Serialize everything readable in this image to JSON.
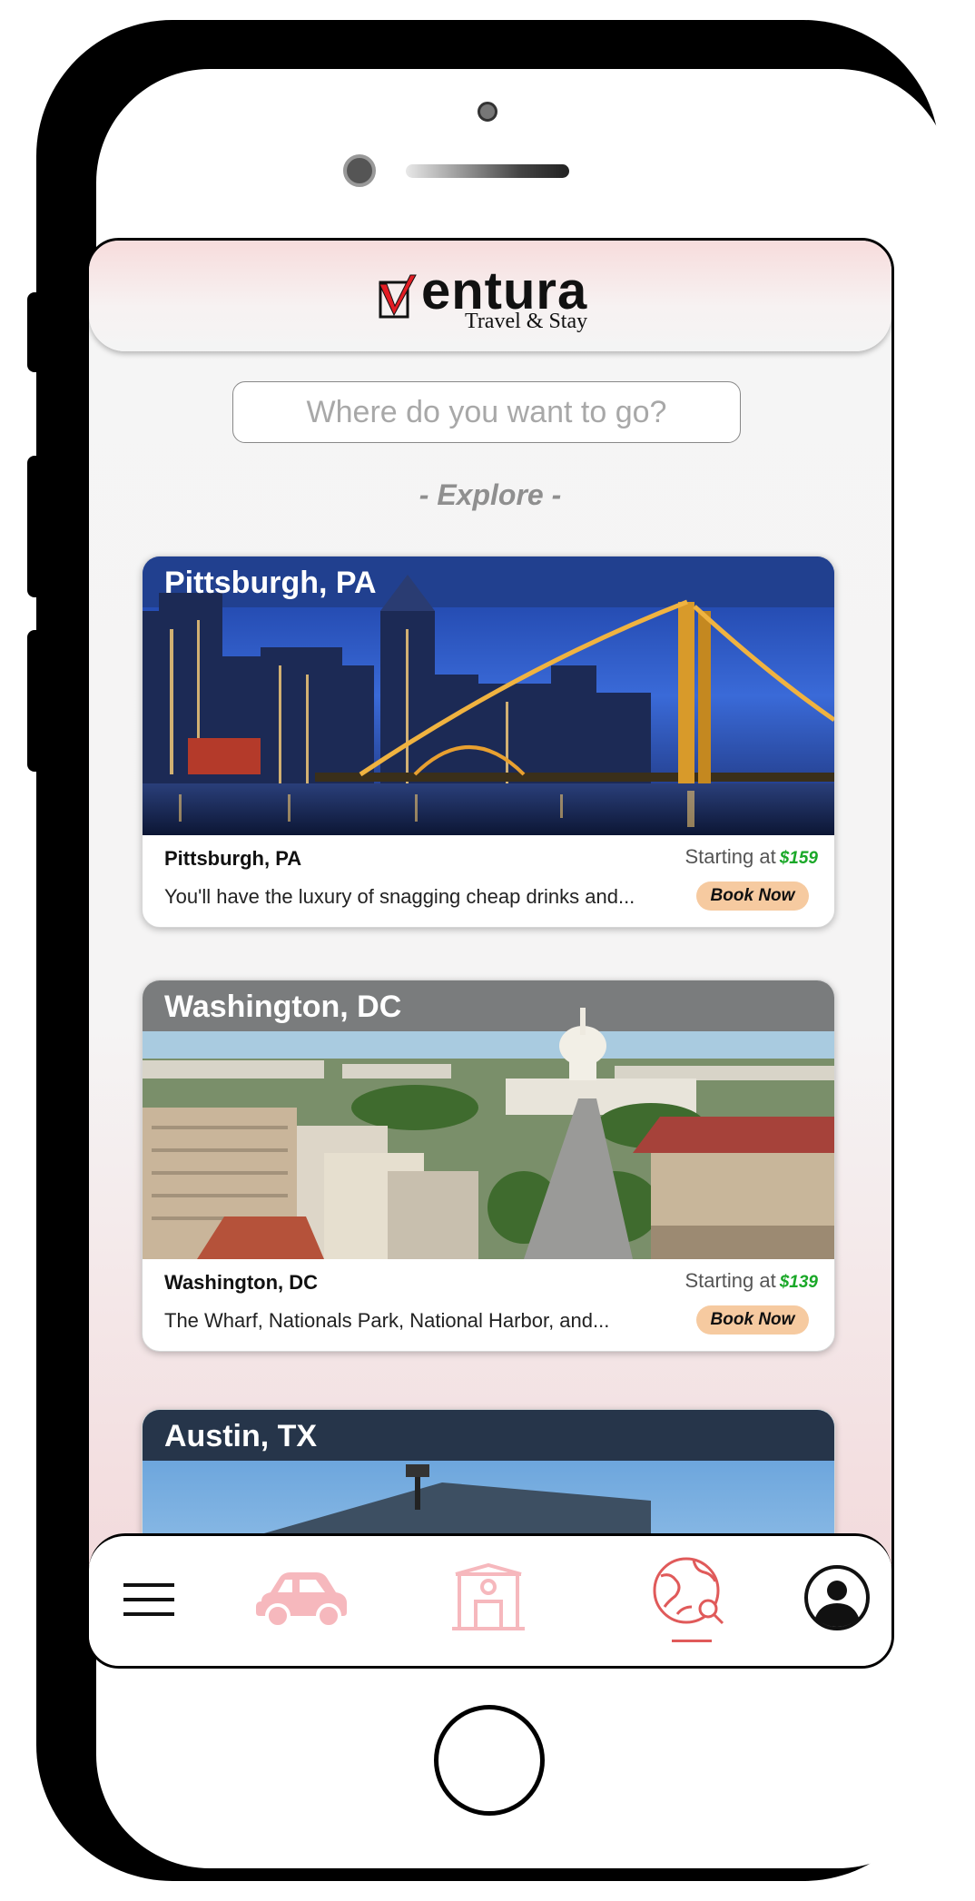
{
  "app": {
    "logo_text": "entura",
    "logo_tagline": "Travel & Stay"
  },
  "search": {
    "placeholder": "Where do you want to go?"
  },
  "section_title": "- Explore -",
  "price_prefix": "Starting at",
  "destinations": [
    {
      "title": "Pittsburgh, PA",
      "name": "Pittsburgh, PA",
      "description": "You'll have the luxury of snagging cheap drinks and...",
      "price": "$159",
      "button": "Book Now"
    },
    {
      "title": "Washington, DC",
      "name": "Washington, DC",
      "description": "The Wharf, Nationals Park, National Harbor, and...",
      "price": "$139",
      "button": "Book Now"
    },
    {
      "title": "Austin, TX"
    }
  ],
  "nav": {
    "items": [
      "menu-icon",
      "car-icon",
      "hotel-icon",
      "explore-globe-icon",
      "profile-icon"
    ],
    "active": "explore-globe-icon"
  },
  "colors": {
    "accent": "#e05a5a",
    "price_green": "#1aa828",
    "book_button": "#f6caa0",
    "nav_inactive": "#f6b8bd"
  }
}
